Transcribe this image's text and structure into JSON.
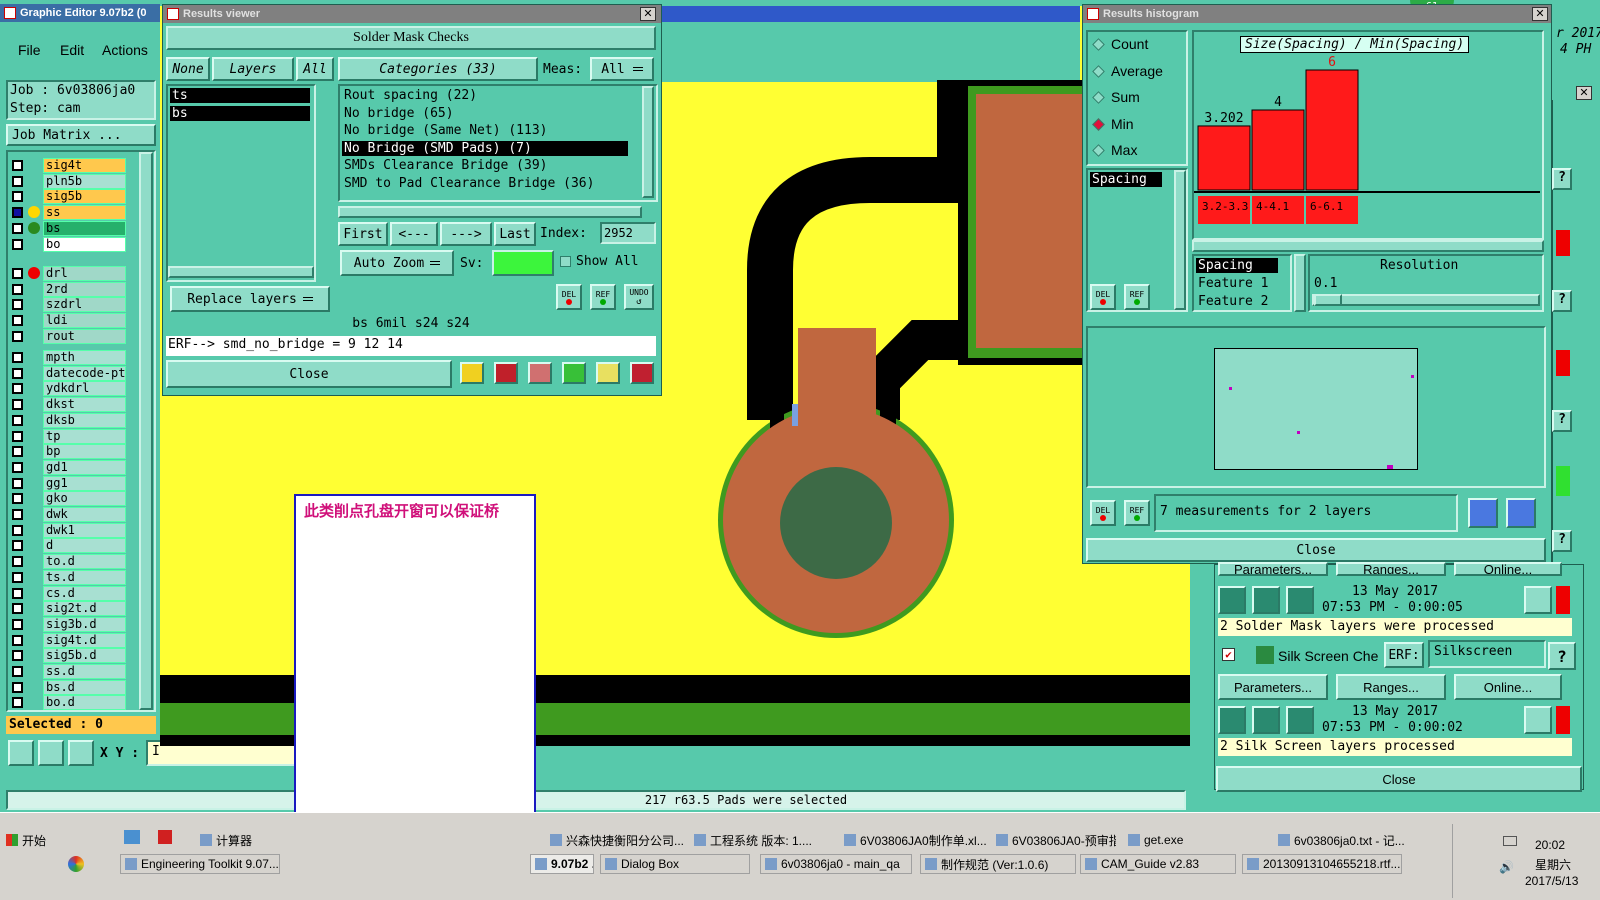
{
  "main_window": {
    "title": "Graphic Editor 9.07b2 (0",
    "menu": [
      "File",
      "Edit",
      "Actions"
    ],
    "job_label": "Job : 6v03806ja0",
    "step_label": "Step: cam",
    "job_matrix": "Job Matrix ...",
    "layers_a": [
      "sig4t",
      "pln5b",
      "sig5b",
      "ss",
      "bs",
      "bo"
    ],
    "layers_b": [
      "drl",
      "2rd",
      "szdrl",
      "ldi",
      "rout"
    ],
    "layers_c": [
      "mpth",
      "datecode-pt",
      "ydkdrl",
      "dkst",
      "dksb",
      "tp",
      "bp",
      "gd1",
      "gg1",
      "gko",
      "dwk",
      "dwk1",
      "d",
      "to.d",
      "ts.d",
      "cs.d",
      "sig2t.d",
      "sig3b.d",
      "sig4t.d",
      "sig5b.d",
      "ss.d",
      "bs.d",
      "bo.d"
    ],
    "selected": "Selected : 0",
    "xy_label": "X Y :",
    "xy_value": "I",
    "status": "217 r63.5 Pads were selected",
    "top_right_date": "r 2017",
    "top_right_time": "4 PH",
    "badge": "61"
  },
  "results_viewer": {
    "title": "Results viewer",
    "header": "Solder Mask Checks",
    "none_btn": "None",
    "layers_btn": "Layers",
    "all_btn": "All",
    "layer_items": [
      "ts",
      "bs"
    ],
    "categories": "Categories (33)",
    "meas_label": "Meas:",
    "meas_value": "All",
    "category_items": [
      "Rout spacing (22)",
      "No bridge (65)",
      "No bridge (Same Net) (113)",
      "No Bridge (SMD Pads) (7)",
      "SMDs Clearance Bridge (39)",
      "SMD to Pad Clearance Bridge (36)"
    ],
    "first": "First",
    "prev": "<---",
    "next": "--->",
    "last": "Last",
    "index_label": "Index:",
    "index_value": "2952",
    "replace_layers": "Replace layers",
    "auto_zoom": "Auto Zoom",
    "sv_label": "Sv:",
    "show_all": "Show All",
    "del": "DEL",
    "ref": "REF",
    "undo": "UNDO",
    "info_line": "bs 6mil  s24  s24",
    "erf_line": "ERF--> smd_no_bridge = 9 12 14",
    "close": "Close"
  },
  "histogram": {
    "title": "Results histogram",
    "stats": [
      "Count",
      "Average",
      "Sum",
      "Min",
      "Max"
    ],
    "selected_stat": "Min",
    "chart_title": "Size(Spacing) / Min(Spacing)",
    "list_item": "Spacing",
    "feature_items": [
      "Spacing",
      "Feature 1",
      "Feature 2"
    ],
    "resolution_label": "Resolution",
    "resolution_value": "0.1",
    "measurements": "7 measurements for 2 layers",
    "close": "Close"
  },
  "chart_data": {
    "type": "bar",
    "title": "Size(Spacing) / Min(Spacing)",
    "categories": [
      "3.2-3.3",
      "4-4.1",
      "6-6.1"
    ],
    "values": [
      3.202,
      4,
      6
    ],
    "value_labels": [
      "3.202",
      "4",
      "6"
    ],
    "bar_color": "#ff1a1a"
  },
  "checklist": {
    "params_btn": "Parameters...",
    "ranges_btn": "Ranges...",
    "online_btn": "Online...",
    "run1_date": "13 May 2017",
    "run1_time": "07:53 PM - 0:00:05",
    "run1_msg": "2 Solder Mask layers were processed",
    "silk_label": "Silk Screen Che",
    "erf_label": "ERF:",
    "erf_value": "Silkscreen",
    "help": "?",
    "run2_date": "13 May 2017",
    "run2_time": "07:53 PM - 0:00:02",
    "run2_msg": "2 Silk Screen layers processed",
    "close": "Close"
  },
  "annotation": {
    "text": "此类削点孔盘开窗可以保证桥"
  },
  "taskbar": {
    "start": "开始",
    "row1": [
      "计算器",
      "兴森快捷衡阳分公司...",
      "工程系统  版本: 1....",
      "6V03806JA0制作单.xl...",
      "6V03806JA0-预审指...",
      "get.exe",
      "6v03806ja0.txt - 记..."
    ],
    "row2": [
      "Engineering Toolkit 9.07...",
      "9.07b2 ...",
      "Dialog Box",
      "6v03806ja0 - main_qa",
      "制作规范 (Ver:1.0.6)",
      "CAM_Guide v2.83",
      "20130913104655218.rtf..."
    ],
    "clock_time": "20:02",
    "clock_day": "星期六",
    "clock_date": "2017/5/13"
  },
  "colors": {
    "panel": "#57c9ab",
    "canvas": "#ffff33",
    "copper": "#c0673f",
    "mask_green": "#3f9a1f",
    "hole": "#3d6a46"
  }
}
